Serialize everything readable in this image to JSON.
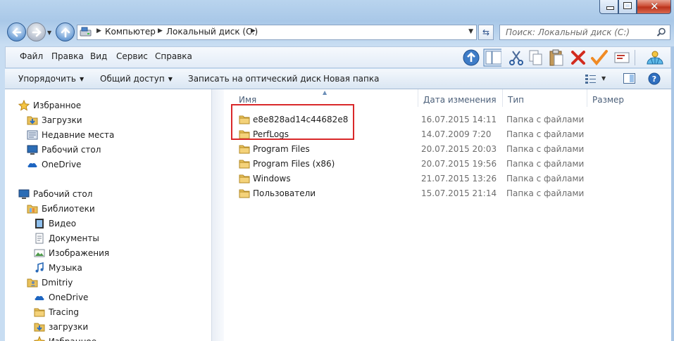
{
  "address": {
    "crumbs": [
      "Компьютер",
      "Локальный диск (C:)"
    ]
  },
  "search": {
    "placeholder": "Поиск: Локальный диск (C:)"
  },
  "menu": {
    "items": [
      "Файл",
      "Правка",
      "Вид",
      "Сервис",
      "Справка"
    ]
  },
  "toolbar_icons": [
    "up-folder-icon",
    "folders-pane-icon",
    "cut-icon",
    "copy-icon",
    "paste-icon",
    "delete-icon",
    "accept-icon",
    "properties-icon",
    "shell-icon"
  ],
  "commands": {
    "organize": "Упорядочить",
    "share": "Общий доступ",
    "burn": "Записать на оптический диск",
    "new_folder": "Новая папка"
  },
  "nav_tree": [
    {
      "label": "Избранное",
      "icon": "star-icon",
      "level": 0
    },
    {
      "label": "Загрузки",
      "icon": "downloads-folder-icon",
      "level": 1
    },
    {
      "label": "Недавние места",
      "icon": "recent-places-icon",
      "level": 1
    },
    {
      "label": "Рабочий стол",
      "icon": "desktop-icon",
      "level": 1
    },
    {
      "label": "OneDrive",
      "icon": "onedrive-icon",
      "level": 1
    },
    {
      "label": "Рабочий стол",
      "icon": "desktop-icon",
      "level": 0
    },
    {
      "label": "Библиотеки",
      "icon": "libraries-icon",
      "level": 1
    },
    {
      "label": "Видео",
      "icon": "video-icon",
      "level": 2
    },
    {
      "label": "Документы",
      "icon": "documents-icon",
      "level": 2
    },
    {
      "label": "Изображения",
      "icon": "pictures-icon",
      "level": 2
    },
    {
      "label": "Музыка",
      "icon": "music-icon",
      "level": 2
    },
    {
      "label": "Dmitriy",
      "icon": "user-folder-icon",
      "level": 1
    },
    {
      "label": "OneDrive",
      "icon": "onedrive-icon",
      "level": 2
    },
    {
      "label": "Tracing",
      "icon": "folder-icon",
      "level": 2
    },
    {
      "label": "загрузки",
      "icon": "downloads-folder-icon",
      "level": 2
    },
    {
      "label": "Избранное",
      "icon": "star-icon",
      "level": 2
    }
  ],
  "columns": [
    "Имя",
    "Дата изменения",
    "Тип",
    "Размер"
  ],
  "files": [
    {
      "name": "e8e828ad14c44682e8",
      "date": "16.07.2015 14:11",
      "type": "Папка с файлами",
      "size": ""
    },
    {
      "name": "PerfLogs",
      "date": "14.07.2009 7:20",
      "type": "Папка с файлами",
      "size": ""
    },
    {
      "name": "Program Files",
      "date": "20.07.2015 20:03",
      "type": "Папка с файлами",
      "size": ""
    },
    {
      "name": "Program Files (x86)",
      "date": "20.07.2015 19:56",
      "type": "Папка с файлами",
      "size": ""
    },
    {
      "name": "Windows",
      "date": "21.07.2015 13:26",
      "type": "Папка с файлами",
      "size": ""
    },
    {
      "name": "Пользователи",
      "date": "15.07.2015 21:14",
      "type": "Папка с файлами",
      "size": ""
    }
  ],
  "colors": {
    "highlight": "#d9282a",
    "accent": "#3d6fb0"
  }
}
